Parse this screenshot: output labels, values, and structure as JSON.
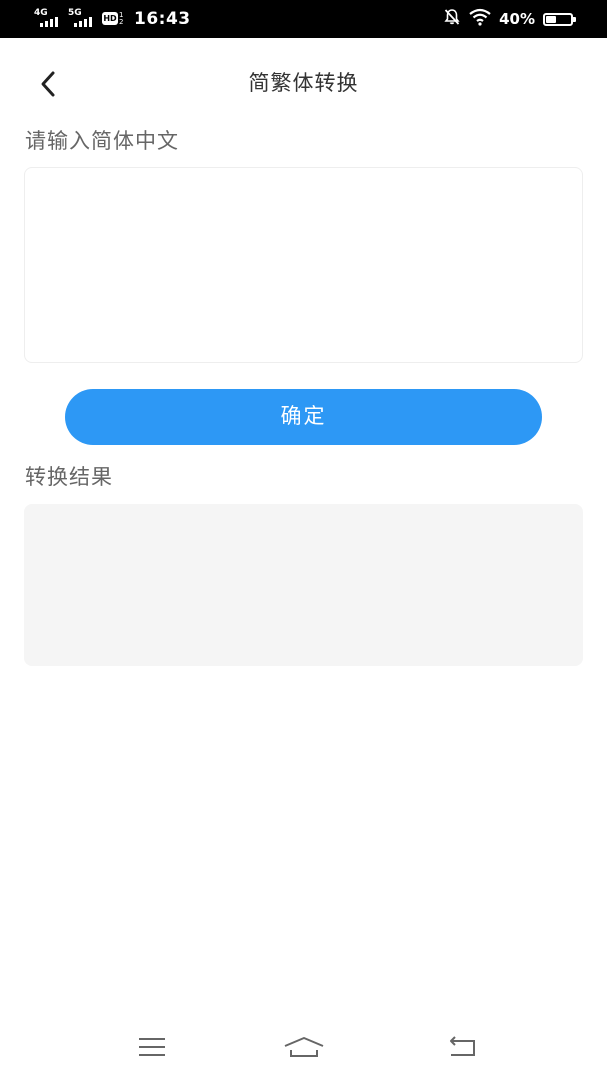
{
  "status_bar": {
    "sim1_network": "4G",
    "sim2_network": "5G",
    "hd_label": "HD",
    "hd_sub": "1 2",
    "time": "16:43",
    "battery_percent": "40%",
    "battery_level": 0.4,
    "icons": [
      "signal-icon",
      "signal-icon",
      "hd-voice-icon",
      "mute-icon",
      "wifi-icon",
      "battery-icon"
    ]
  },
  "header": {
    "title": "简繁体转换",
    "back_icon": "chevron-left-icon"
  },
  "input_section": {
    "label": "请输入简体中文",
    "value": "",
    "placeholder": ""
  },
  "confirm_button": {
    "label": "确定",
    "color": "#2d98f5"
  },
  "result_section": {
    "label": "转换结果",
    "value": ""
  },
  "nav_bar": {
    "icons": [
      "menu-icon",
      "home-icon",
      "back-icon"
    ]
  },
  "colors": {
    "accent": "#2d98f5",
    "result_bg": "#f5f5f5",
    "label_text": "#666666",
    "title_text": "#333333"
  }
}
